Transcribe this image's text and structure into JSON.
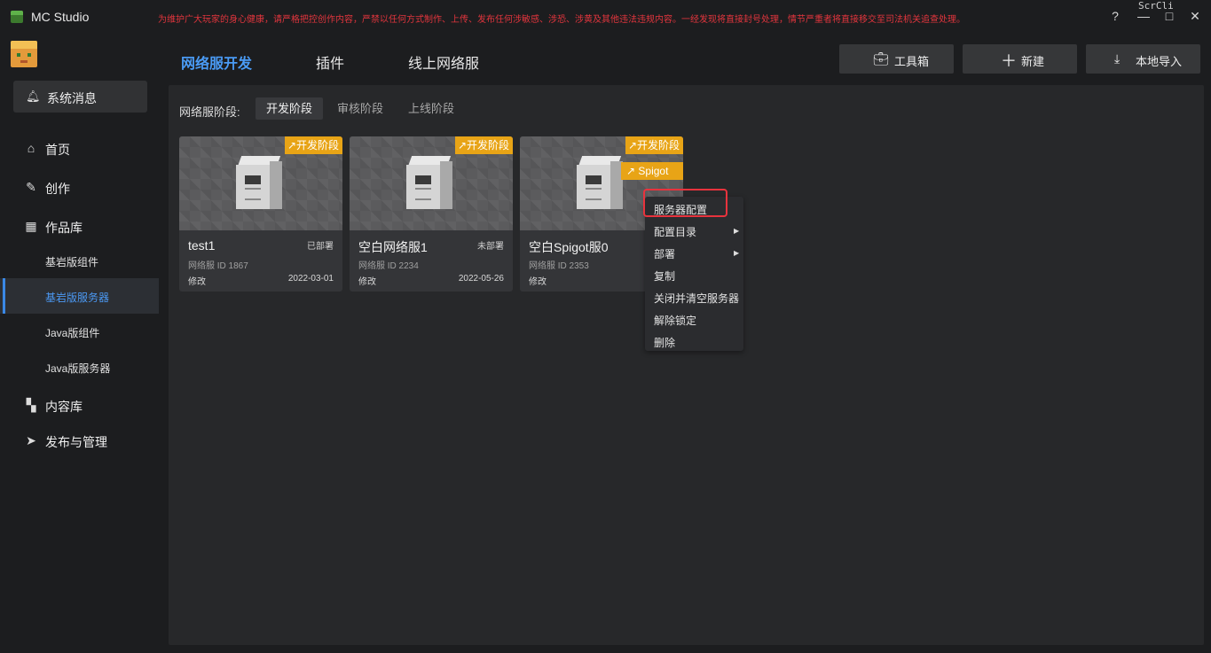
{
  "app": {
    "title": "MC Studio",
    "notice": "为维护广大玩家的身心健康，请严格把控创作内容，严禁以任何方式制作、上传、发布任何涉敏感、涉恐、涉黄及其他违法违规内容。一经发现将直接封号处理，情节严重者将直接移交至司法机关追查处理。",
    "corner_text": "ScrCli",
    "help_icon": "?",
    "minimize_icon": "—",
    "maximize_icon": "□",
    "close_icon": "✕"
  },
  "sidebar": {
    "messages_label": "系统消息",
    "items": [
      {
        "label": "首页",
        "icon": "home-icon"
      },
      {
        "label": "创作",
        "icon": "pen-icon"
      },
      {
        "label": "作品库",
        "icon": "library-icon"
      }
    ],
    "sub_items": [
      {
        "label": "基岩版组件",
        "active": false
      },
      {
        "label": "基岩版服务器",
        "active": true
      },
      {
        "label": "Java版组件",
        "active": false
      },
      {
        "label": "Java版服务器",
        "active": false
      }
    ],
    "bottom_items": [
      {
        "label": "内容库",
        "icon": "grid-icon"
      },
      {
        "label": "发布与管理",
        "icon": "send-icon"
      }
    ]
  },
  "header": {
    "tabs": [
      {
        "label": "网络服开发",
        "active": true
      },
      {
        "label": "插件",
        "active": false
      },
      {
        "label": "线上网络服",
        "active": false
      }
    ],
    "buttons": {
      "toolbox": "工具箱",
      "new": "新建",
      "import": "本地导入"
    }
  },
  "stages": {
    "label": "网络服阶段:",
    "items": [
      {
        "label": "开发阶段",
        "active": true
      },
      {
        "label": "审核阶段",
        "active": false
      },
      {
        "label": "上线阶段",
        "active": false
      }
    ]
  },
  "cards": [
    {
      "name": "test1",
      "status": "已部署",
      "id": "网络服 ID 1867",
      "modified": "修改",
      "date": "2022-03-01",
      "badge": "↗开发阶段"
    },
    {
      "name": "空白网络服1",
      "status": "未部署",
      "id": "网络服 ID 2234",
      "modified": "修改",
      "date": "2022-05-26",
      "badge": "↗开发阶段"
    },
    {
      "name": "空白Spigot服0",
      "status": "",
      "id": "网络服 ID 2353",
      "modified": "修改",
      "date": "",
      "badge": "↗开发阶段",
      "badge2": "↗  Spigot"
    }
  ],
  "context_menu": {
    "items": [
      {
        "label": "服务器配置",
        "submenu": false
      },
      {
        "label": "配置目录",
        "submenu": true
      },
      {
        "label": "部署",
        "submenu": true
      },
      {
        "label": "复制",
        "submenu": false
      },
      {
        "label": "关闭并清空服务器",
        "submenu": false
      },
      {
        "label": "解除锁定",
        "submenu": false
      },
      {
        "label": "删除",
        "submenu": false
      }
    ],
    "submenu_arrow": "▶"
  },
  "colors": {
    "accent": "#4a9bf5",
    "badge": "#e8a416",
    "notice": "#e2353d",
    "highlight": "#e8333d"
  }
}
